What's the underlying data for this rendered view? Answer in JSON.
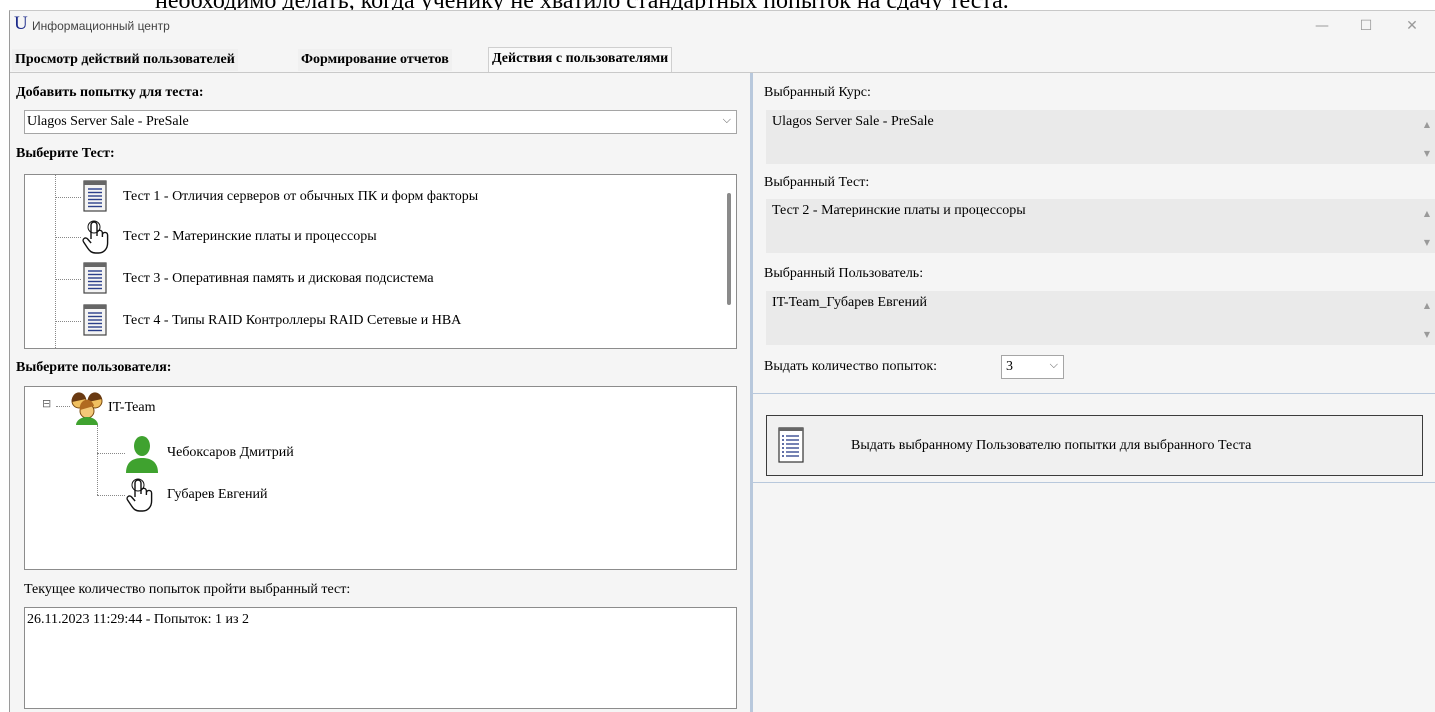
{
  "background_text": "необходимо делать, когда ученику не хватило стандартных попыток на сдачу теста.",
  "window": {
    "title": "Информационный центр",
    "app_icon": "U",
    "controls": {
      "minimize": "—",
      "maximize": "☐",
      "close": "✕"
    }
  },
  "tabs": [
    {
      "label": "Просмотр действий пользователей",
      "active": false
    },
    {
      "label": "Формирование отчетов",
      "active": false
    },
    {
      "label": "Действия с пользователями",
      "active": true
    }
  ],
  "left": {
    "add_attempt_label": "Добавить попытку для теста:",
    "course_combo": {
      "value": "Ulagos Server Sale - PreSale",
      "arrow": "⌵"
    },
    "select_test_label": "Выберите Тест:",
    "tests": [
      {
        "label": "Тест 1 - Отличия серверов от обычных ПК и форм факторы",
        "icon": "document-list-icon"
      },
      {
        "label": "Тест 2 - Материнские платы и процессоры",
        "icon": "hand-pointer-icon"
      },
      {
        "label": "Тест 3 - Оперативная память и дисковая подсистема",
        "icon": "document-list-icon"
      },
      {
        "label": "Тест 4 - Типы RAID Контроллеры RAID Сетевые и HBA",
        "icon": "document-list-icon"
      }
    ],
    "select_user_label": "Выберите пользователя:",
    "user_tree": {
      "group": {
        "label": "IT-Team",
        "expander": "⊟",
        "icon": "user-group-icon"
      },
      "users": [
        {
          "label": "Чебоксаров Дмитрий",
          "icon": "user-icon"
        },
        {
          "label": "Губарев Евгений",
          "icon": "hand-pointer-icon"
        }
      ]
    },
    "current_attempts_label": "Текущее количество попыток пройти выбранный тест:",
    "attempts_log": "26.11.2023 11:29:44  - Попыток: 1 из 2"
  },
  "right": {
    "selected_course_label": "Выбранный Курс:",
    "selected_course_value": "Ulagos Server Sale - PreSale",
    "selected_test_label": "Выбранный Тест:",
    "selected_test_value": "Тест 2 - Материнские платы и процессоры",
    "selected_user_label": "Выбранный Пользователь:",
    "selected_user_value": "IT-Team_Губарев Евгений",
    "attempts_count_label": "Выдать количество попыток:",
    "attempts_count_value": "3",
    "issue_button_label": "Выдать выбранному Пользователю попытки для выбранного Теста"
  },
  "colors": {
    "splitter": "#b8c8dc",
    "app_icon": "#1c2a8a",
    "user_icon": "#3fa22f"
  }
}
